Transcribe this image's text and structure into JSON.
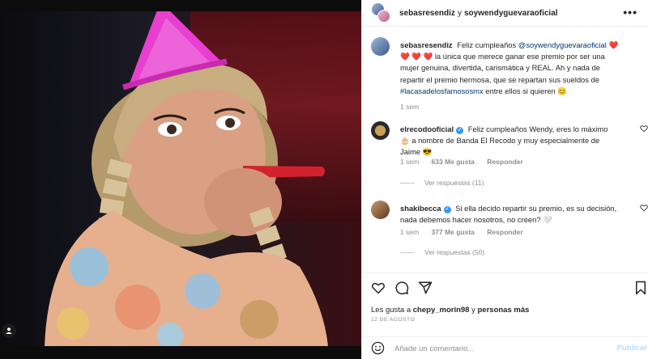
{
  "post": {
    "header": {
      "author": "sebasresendiz",
      "conjunction": "y",
      "collaborator": "soywendyguevaraoficial",
      "more_label": "•••"
    },
    "caption": {
      "username": "sebasresendiz",
      "text_before": "Feliz cumpleaños",
      "mention": "@soywendyguevaraoficial",
      "hearts": "❤️ ❤️ ❤️ ❤️",
      "text_middle": "la única que merece ganar ese premio por ser una mujer genuina, divertida, carismática y REAL. Ah y nada de repartir el premio hermosa, que se repartan sus sueldos de",
      "hashtag": "#lacasadelosfamososmx",
      "text_after": "entre ellos si quieren",
      "emoji": "😊",
      "time": "1 sem"
    },
    "comments": [
      {
        "username": "elrecodooficial",
        "verified": true,
        "text": "Feliz cumpleaños Wendy, eres lo máximo 🎂 a nombre de Banda El Recodo y muy especialmente de Jaime 😎",
        "time": "1 sem",
        "likes": "633 Me gusta",
        "reply_label": "Responder",
        "view_replies": "Ver respuestas (11)"
      },
      {
        "username": "shakibecca",
        "verified": true,
        "text": "Si ella decido repartir su premio, es su decisión, nada debemos hacer nosotros, no creen? 🤍",
        "time": "1 sem",
        "likes": "377 Me gusta",
        "reply_label": "Responder",
        "view_replies": "Ver respuestas (50)"
      }
    ],
    "likes": {
      "prefix": "Les gusta a",
      "first_user": "chepy_morin98",
      "connector": "y",
      "others": "personas más"
    },
    "date": "12 DE AGOSTO",
    "add_comment": {
      "placeholder": "Añade un comentario...",
      "publish_label": "Publicar"
    },
    "icons": {
      "like": "heart-icon",
      "comment": "comment-icon",
      "share": "paper-plane-icon",
      "save": "bookmark-icon",
      "emoji": "smiley-icon",
      "tag": "user-tag-icon"
    },
    "colors": {
      "link": "#00376b",
      "verified": "#3897f0",
      "publish_disabled": "#b2dffc",
      "party_hat": "#e83fd0"
    }
  }
}
